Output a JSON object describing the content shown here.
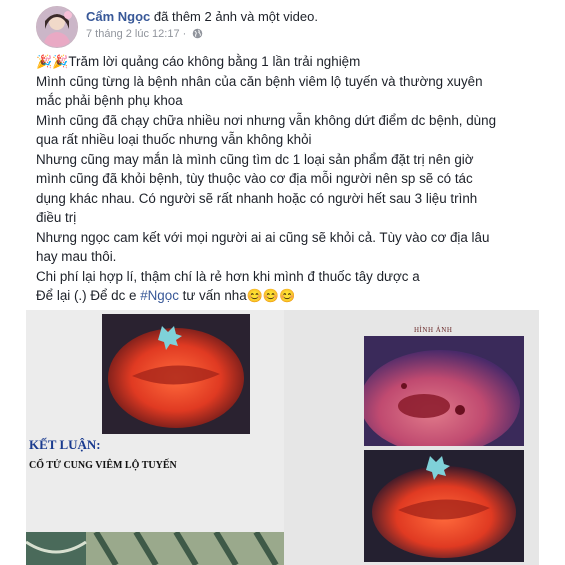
{
  "post": {
    "author": "Cẩm Ngọc",
    "action": " đã thêm 2 ảnh và một video.",
    "timestamp": "7 tháng 2 lúc 12:17 · ",
    "privacy_icon": "globe-icon",
    "lines": [
      "Trăm lời quảng cáo không bằng 1 lần trải nghiệm",
      "Mình cũng từng là bệnh nhân của căn bệnh viêm lộ tuyến và thường xuyên",
      "mắc phải bệnh phụ khoa",
      "Mình cũng đã chạy chữa nhiều nơi nhưng vẫn không dứt điểm dc bệnh, dùng",
      "qua rất nhiều loại thuốc nhưng vẫn không khỏi",
      "Nhưng cũng may mắn là mình cũng tìm dc 1 loại sản phẩm đặt trị nên giờ",
      "mình cũng đã khỏi bệnh, tùy thuộc vào cơ địa mỗi người nên sp sẽ có tác",
      "dụng khác nhau. Có người sẽ rất nhanh hoặc có người hết sau 3 liệu trình",
      "điều trị",
      "Nhưng ngọc cam kết với mọi người ai ai cũng sẽ khỏi cả. Tùy vào cơ địa lâu",
      "hay mau thôi.",
      "Chi phí lại hợp lí, thậm chí là rẻ hơn khi mình đ thuốc tây dược a"
    ],
    "lead_emoji": "🎉🎉",
    "last_line_prefix": "Để lại (.) Để dc e ",
    "hashtag": "#Ngọc",
    "last_line_suffix": " tư vấn nha",
    "trailing_emoji": "😊😊😊"
  },
  "photos": {
    "ket_luan": "KẾT LUẬN:",
    "diagnosis": "CỔ TỬ CUNG VIÊM LỘ TUYẾN",
    "hinh_anh": "HÌNH ẢNH"
  },
  "colors": {
    "link": "#385898",
    "meta": "#90949c",
    "text": "#1d2129"
  }
}
